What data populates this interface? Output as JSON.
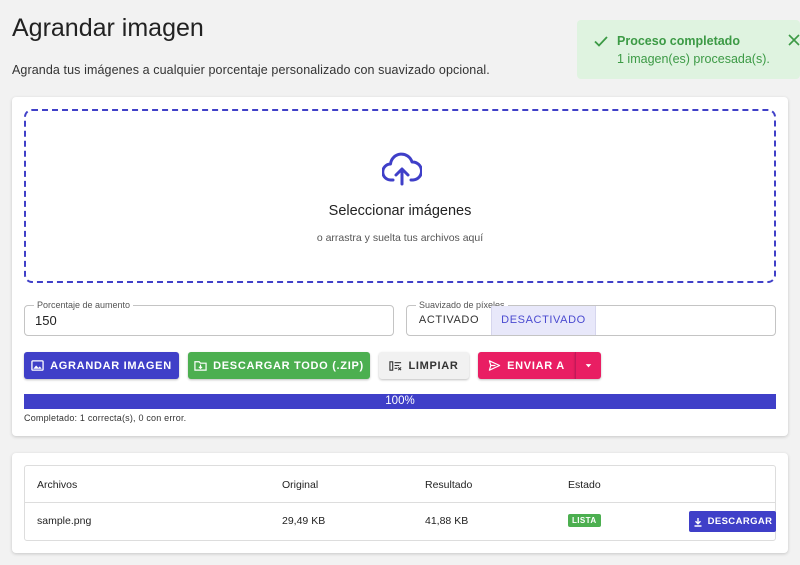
{
  "page": {
    "title": "Agrandar imagen",
    "subtitle": "Agranda tus imágenes a cualquier porcentaje personalizado con suavizado opcional."
  },
  "toast": {
    "title": "Proceso completado",
    "message": "1 imagen(es) procesada(s).",
    "icons": [
      "check-icon",
      "close-icon"
    ]
  },
  "dropzone": {
    "icon": "cloud-upload-icon",
    "title": "Seleccionar imágenes",
    "subtitle": "o arrastra y suelta tus archivos aquí"
  },
  "form": {
    "percent_label": "Porcentaje de aumento",
    "percent_value": "150",
    "smoothing_label": "Suavizado de píxeles",
    "smoothing_on": "ACTIVADO",
    "smoothing_off": "DESACTIVADO",
    "smoothing_selected": "DESACTIVADO"
  },
  "actions": {
    "enlarge": "AGRANDAR IMAGEN",
    "download_all": "DESCARGAR TODO (.ZIP)",
    "clear": "LIMPIAR",
    "send_to": "ENVIAR A"
  },
  "progress": {
    "value": 100,
    "label": "100%",
    "status": "Completado: 1 correcta(s), 0 con error."
  },
  "table": {
    "headers": [
      "Archivos",
      "Original",
      "Resultado",
      "Estado"
    ],
    "rows": [
      {
        "file": "sample.png",
        "original": "29,49 KB",
        "result": "41,88 KB",
        "status": "LISTA",
        "action": "DESCARGAR"
      }
    ]
  },
  "colors": {
    "primary": "#3f3fc8",
    "success": "#4caf50",
    "accent": "#e91e63",
    "toast_bg": "#dff3e0"
  }
}
